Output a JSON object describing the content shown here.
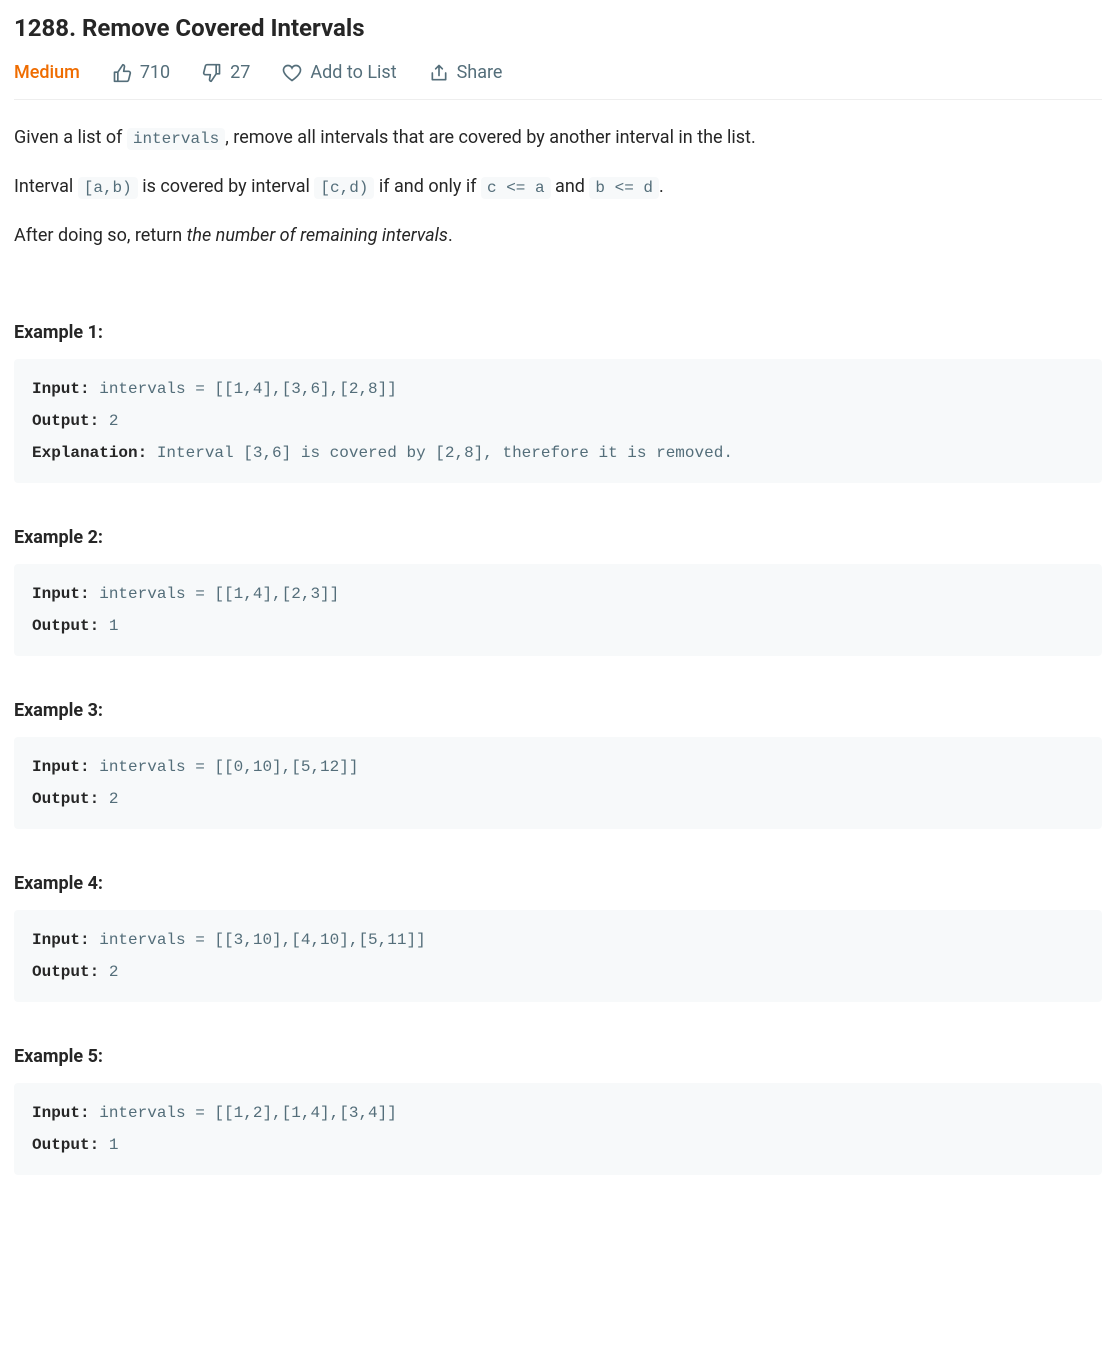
{
  "title": "1288. Remove Covered Intervals",
  "difficulty": "Medium",
  "meta": {
    "likes": "710",
    "dislikes": "27",
    "addToList": "Add to List",
    "share": "Share"
  },
  "description": {
    "p1_pre": "Given a list of ",
    "p1_code": "intervals",
    "p1_post": ", remove all intervals that are covered by another interval in the list.",
    "p2_pre": "Interval ",
    "p2_code1": "[a,b)",
    "p2_mid1": " is covered by interval ",
    "p2_code2": "[c,d)",
    "p2_mid2": " if and only if ",
    "p2_code3": "c <= a",
    "p2_mid3": " and ",
    "p2_code4": "b <= d",
    "p2_post": ".",
    "p3_pre": "After doing so, return ",
    "p3_em": "the number of remaining intervals",
    "p3_post": "."
  },
  "labels": {
    "input": "Input:",
    "output": "Output:",
    "explanation": "Explanation:"
  },
  "examples": [
    {
      "title": "Example 1:",
      "input": " intervals = [[1,4],[3,6],[2,8]]",
      "output": " 2",
      "explanation": " Interval [3,6] is covered by [2,8], therefore it is removed."
    },
    {
      "title": "Example 2:",
      "input": " intervals = [[1,4],[2,3]]",
      "output": " 1"
    },
    {
      "title": "Example 3:",
      "input": " intervals = [[0,10],[5,12]]",
      "output": " 2"
    },
    {
      "title": "Example 4:",
      "input": " intervals = [[3,10],[4,10],[5,11]]",
      "output": " 2"
    },
    {
      "title": "Example 5:",
      "input": " intervals = [[1,2],[1,4],[3,4]]",
      "output": " 1"
    }
  ]
}
